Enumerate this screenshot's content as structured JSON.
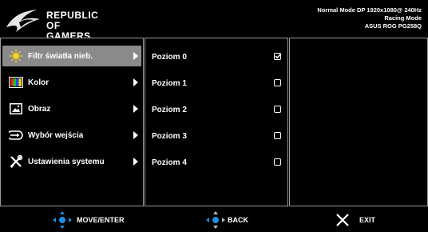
{
  "header": {
    "brand_line1": "REPUBLIC OF",
    "brand_line2": "GAMERS",
    "status_line1": "Normal Mode DP 1920x1080@ 240Hz",
    "status_line2": "Racing Mode",
    "status_line3": "ASUS ROG PG258Q"
  },
  "menu": {
    "items": [
      {
        "label": "Filtr światła nieb.",
        "icon": "light-filter-icon",
        "selected": true
      },
      {
        "label": "Kolor",
        "icon": "color-palette-icon",
        "selected": false
      },
      {
        "label": "Obraz",
        "icon": "image-icon",
        "selected": false
      },
      {
        "label": "Wybór wejścia",
        "icon": "input-select-icon",
        "selected": false
      },
      {
        "label": "Ustawienia systemu",
        "icon": "tools-icon",
        "selected": false
      }
    ]
  },
  "options": {
    "items": [
      {
        "label": "Poziom 0",
        "checked": true
      },
      {
        "label": "Poziom 1",
        "checked": false
      },
      {
        "label": "Poziom 2",
        "checked": false
      },
      {
        "label": "Poziom 3",
        "checked": false
      },
      {
        "label": "Poziom 4",
        "checked": false
      }
    ]
  },
  "footer": {
    "move_label": "MOVE/ENTER",
    "back_label": "BACK",
    "exit_label": "EXIT"
  },
  "colors": {
    "background": "#000000",
    "selected": "#8a8a8a",
    "accent_blue": "#1f8fe0",
    "panel_border": "#9a9a9a"
  }
}
